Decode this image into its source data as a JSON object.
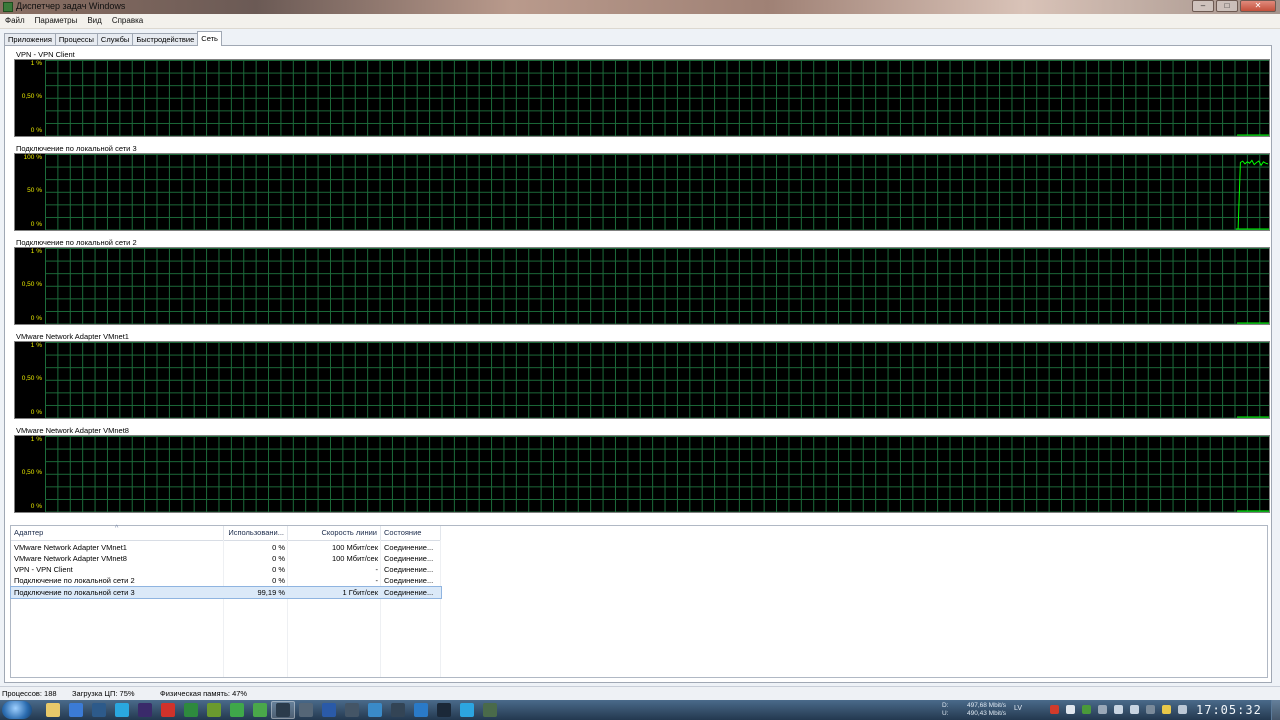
{
  "window": {
    "title": "Диспетчер задач Windows",
    "controls": [
      "–",
      "□",
      "✕"
    ]
  },
  "menu": [
    "Файл",
    "Параметры",
    "Вид",
    "Справка"
  ],
  "tabs": [
    {
      "label": "Приложения",
      "active": false
    },
    {
      "label": "Процессы",
      "active": false
    },
    {
      "label": "Службы",
      "active": false
    },
    {
      "label": "Быстродействие",
      "active": false
    },
    {
      "label": "Сеть",
      "active": true
    }
  ],
  "graphs": [
    {
      "title": "VPN - VPN Client",
      "ticks": [
        "1 %",
        "0,50 %",
        "0 %"
      ],
      "ymax": 1,
      "activity": []
    },
    {
      "title": "Подключение по локальной сети 3",
      "ticks": [
        "100 %",
        "50 %",
        "0 %"
      ],
      "ymax": 100,
      "activity": [
        0,
        0,
        95,
        97,
        93,
        96,
        94,
        98,
        92,
        95,
        97,
        91,
        96,
        94,
        93
      ]
    },
    {
      "title": "Подключение по локальной сети 2",
      "ticks": [
        "1 %",
        "0,50 %",
        "0 %"
      ],
      "ymax": 1,
      "activity": []
    },
    {
      "title": "VMware Network Adapter VMnet1",
      "ticks": [
        "1 %",
        "0,50 %",
        "0 %"
      ],
      "ymax": 1,
      "activity": []
    },
    {
      "title": "VMware Network Adapter VMnet8",
      "ticks": [
        "1 %",
        "0,50 %",
        "0 %"
      ],
      "ymax": 1,
      "activity": []
    }
  ],
  "table": {
    "headers": {
      "adapter": "Адаптер",
      "usage": "Использовани...",
      "speed": "Скорость линии",
      "status": "Состояние"
    },
    "sort_indicator": "^",
    "rows": [
      {
        "adapter": "VMware Network Adapter VMnet1",
        "usage": "0 %",
        "speed": "100 Мбит/сек",
        "status": "Соединение...",
        "selected": false
      },
      {
        "adapter": "VMware Network Adapter VMnet8",
        "usage": "0 %",
        "speed": "100 Мбит/сек",
        "status": "Соединение...",
        "selected": false
      },
      {
        "adapter": "VPN - VPN Client",
        "usage": "0 %",
        "speed": "-",
        "status": "Соединение...",
        "selected": false
      },
      {
        "adapter": "Подключение по локальной сети 2",
        "usage": "0 %",
        "speed": "-",
        "status": "Соединение...",
        "selected": false
      },
      {
        "adapter": "Подключение по локальной сети 3",
        "usage": "99,19 %",
        "speed": "1 Гбит/сек",
        "status": "Соединение...",
        "selected": true
      }
    ]
  },
  "statusbar": {
    "processes": "Процессов: 188",
    "cpu": "Загрузка ЦП: 75%",
    "memory": "Физическая память: 47%"
  },
  "taskbar": {
    "net_down_label": "D:",
    "net_down": "497,68 Mbit/s",
    "net_up_label": "U:",
    "net_up": "490,43 Mbit/s",
    "lang": "LV",
    "clock": "17:05:32",
    "icons": [
      "explorer-icon",
      "media-icon",
      "network-icon",
      "skype-icon",
      "premiere-icon",
      "opera-icon",
      "excel-icon",
      "utorrent-icon",
      "evernote-icon",
      "task-manager-icon",
      "app-icon",
      "app-icon",
      "word-icon",
      "app-icon",
      "app-icon",
      "app-icon",
      "browser-icon",
      "steam-icon",
      "telegram-icon",
      "taskmgr-icon"
    ]
  },
  "colors": {
    "graph_bg": "#000000",
    "grid": "#1c6b3a",
    "line": "#00ff00",
    "axis_text": "#e8e800"
  }
}
